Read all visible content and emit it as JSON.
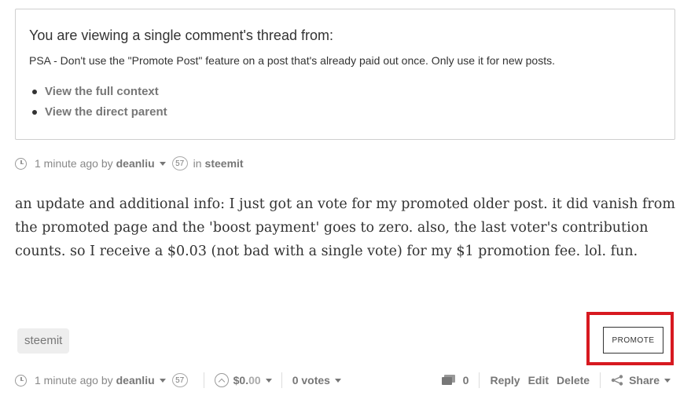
{
  "thread": {
    "title": "You are viewing a single comment's thread from:",
    "post_title": "PSA - Don't use the \"Promote Post\" feature on a post that's already paid out once. Only use it for new posts.",
    "links": [
      "View the full context",
      "View the direct parent"
    ]
  },
  "top_meta": {
    "time": "1 minute ago by",
    "author": "deanliu",
    "reputation": "57",
    "in_label": "in",
    "category": "steemit"
  },
  "comment": {
    "body": "an update and additional info: I just got an vote for my promoted older post. it did vanish from the promoted page and the 'boost payment' goes to zero. also, the last voter's contribution counts. so I receive a $0.03 (not bad with a single vote) for my $1 promotion fee. lol. fun."
  },
  "tags": [
    "steemit"
  ],
  "promote_label": "PROMOTE",
  "highlight_color": "#d71920",
  "bottom_meta": {
    "time": "1 minute ago by",
    "author": "deanliu",
    "reputation": "57",
    "payout_main": "$0.",
    "payout_cents": "00",
    "votes": "0 votes",
    "replies_count": "0",
    "actions": [
      "Reply",
      "Edit",
      "Delete"
    ],
    "share_label": "Share"
  },
  "icons": [
    "clock-icon",
    "caret-down-icon",
    "upvote-icon",
    "comment-icon",
    "share-icon"
  ]
}
